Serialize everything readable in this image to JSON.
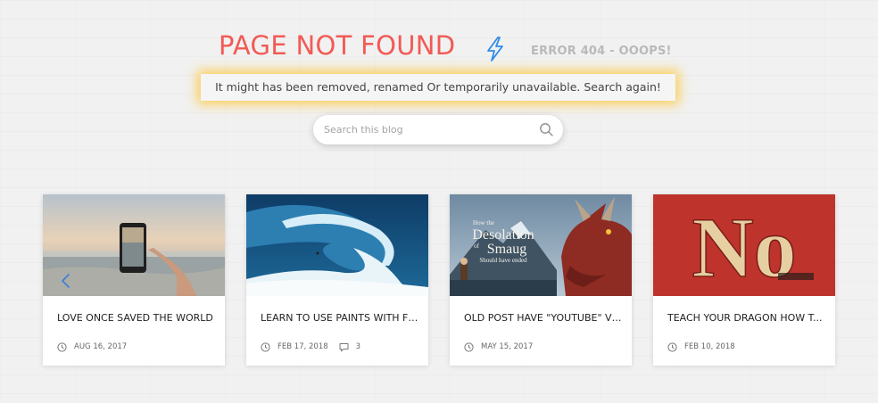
{
  "header": {
    "title": "PAGE NOT FOUND",
    "icon": "lightning-bolt-icon",
    "error_text": "ERROR 404 - OOOPS!"
  },
  "notice": {
    "text": "It might has been removed, renamed Or temporarily unavailable. Search again!"
  },
  "search": {
    "placeholder": "Search this blog",
    "value": "",
    "icon": "search-icon"
  },
  "colors": {
    "title": "#f25a55",
    "bolt": "#2f8ce6",
    "notice_glow": "#ffc428",
    "error_text": "#b9b9b9"
  },
  "carousel": {
    "prev_icon": "chevron-left-icon"
  },
  "posts": [
    {
      "title": "LOVE ONCE SAVED THE WORLD",
      "date": "AUG 16, 2017",
      "comments": null,
      "image": "phone-at-beach"
    },
    {
      "title": "LEARN TO USE PAINTS WITH FE...",
      "date": "FEB 17, 2018",
      "comments": "3",
      "image": "surfer-wave"
    },
    {
      "title": "OLD POST HAVE \"YOUTUBE\" VI...",
      "date": "MAY 15, 2017",
      "comments": null,
      "image": "desolation-of-smaug-dragon"
    },
    {
      "title": "TEACH YOUR DRAGON HOW T...",
      "date": "FEB 10, 2018",
      "comments": null,
      "image": "no-sign-red-wall"
    }
  ],
  "thumb_text": {
    "line1": "How the",
    "line2": "Desolation",
    "line3": "of",
    "line4": "Smaug",
    "line5": "Should have ended",
    "no_sign": "No"
  }
}
